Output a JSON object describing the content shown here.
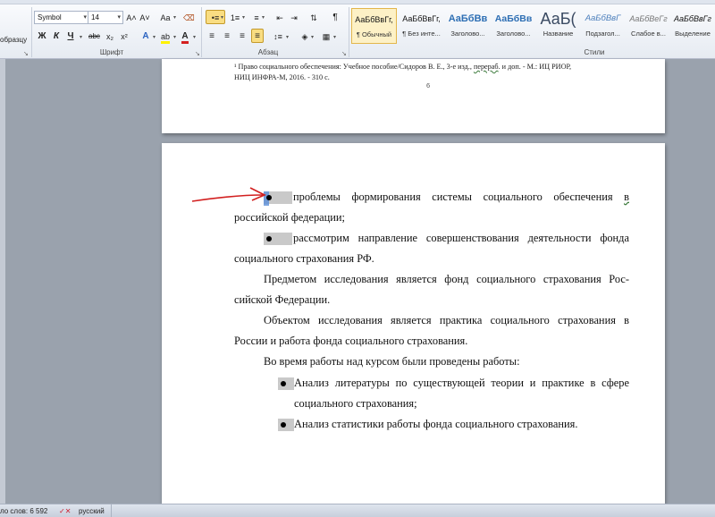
{
  "ribbon": {
    "clipboard": {
      "format_painter_label": "образцу"
    },
    "font": {
      "group_label": "Шрифт",
      "family": "Symbol",
      "size": "14",
      "grow_icon": "A˄",
      "shrink_icon": "A˅",
      "case_icon": "Aa",
      "bold": "Ж",
      "italic": "К",
      "underline": "Ч",
      "strike": "abc",
      "subscript": "x₂",
      "superscript": "x²"
    },
    "paragraph": {
      "group_label": "Абзац",
      "pilcrow": "¶"
    },
    "styles": {
      "group_label": "Стили",
      "items": [
        {
          "preview": "АаБбВвГг,",
          "name": "¶ Обычный"
        },
        {
          "preview": "АаБбВвГг,",
          "name": "¶ Без инте..."
        },
        {
          "preview": "АаБбВв",
          "name": "Заголово..."
        },
        {
          "preview": "АаБбВв",
          "name": "Заголово..."
        },
        {
          "preview": "АаБ(",
          "name": "Название"
        },
        {
          "preview": "АаБбВвГ",
          "name": "Подзагол..."
        },
        {
          "preview": "АаБбВеГг",
          "name": "Слабое в..."
        },
        {
          "preview": "АаБбВвГг",
          "name": "Выделение"
        }
      ]
    },
    "colors": {
      "accent_active": "#f9dd82",
      "heading_blue": "#2e6fb4",
      "highlight_yellow": "#fff200",
      "font_red": "#d42020"
    }
  },
  "prev_page": {
    "footnote_line1_a": "¹ Право социального обеспечения: Учебное пособие/Сидоров В. Е., 3-е изд., ",
    "footnote_line1_u": "перераб",
    "footnote_line1_b": ". и доп. - М.: ИЦ РИОР,",
    "footnote_line2": "НИЦ ИНФРА-М, 2016. - 310 с.",
    "page_number": "6"
  },
  "document": {
    "bullet1_line1_text": "проблемы формирования системы социального обеспечения ",
    "bullet1_line1_end": "в",
    "bullet1_line2": "российской федерации;",
    "bullet2_line1": "рассмотрим направление совершенствования деятельности фонда",
    "bullet2_line2": "социального страхования РФ.",
    "para1_line1": "Предметом исследования является фонд социального страхования Рос-",
    "para1_line2": "сийской Федерации.",
    "para2_line1": "Объектом исследования является практика социального страхования в",
    "para2_line2": "России и работа фонда социального страхования.",
    "para3_line1": "Во время работы над курсом были проведены работы:",
    "sub1_line1": "Анализ литературы по существующей теории и практике в сфере",
    "sub1_line2": "социального страхования;",
    "sub2_line1": "Анализ статистики работы фонда социального страхования."
  },
  "status": {
    "words": "ло слов: 6 592",
    "language": "русский"
  }
}
